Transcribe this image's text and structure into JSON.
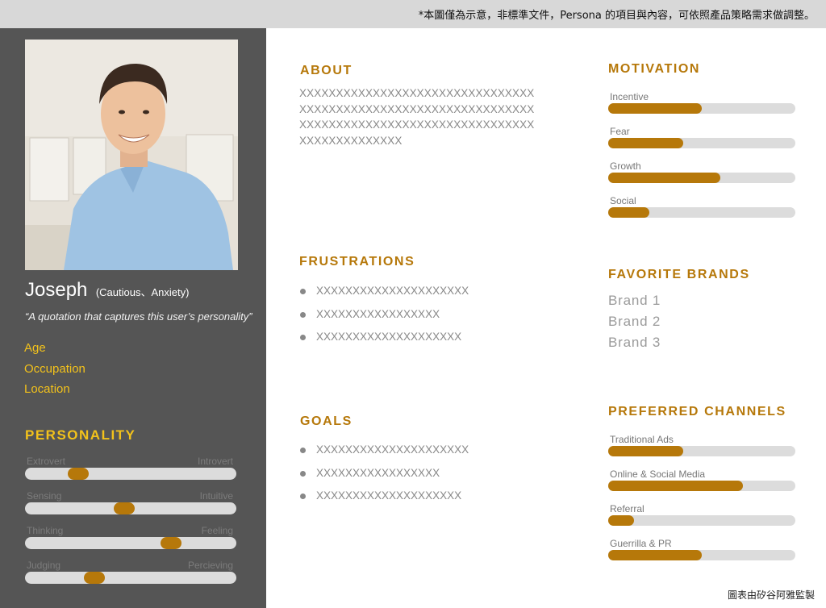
{
  "header": {
    "note": "*本圖僅為示意，非標準文件，Persona 的項目與內容，可依照產品策略需求做調整。"
  },
  "profile": {
    "name": "Joseph",
    "traits": "(Cautious、Anxiety)",
    "quote": "“A quotation that captures this user’s personality”",
    "facts": [
      "Age",
      "Occupation",
      "Location"
    ]
  },
  "personality": {
    "title": "PERSONALITY",
    "traits": [
      {
        "left": "Extrovert",
        "right": "Introvert",
        "value": 0.25
      },
      {
        "left": "Sensing",
        "right": "Intuitive",
        "value": 0.47
      },
      {
        "left": "Thinking",
        "right": "Feeling",
        "value": 0.69
      },
      {
        "left": "Judging",
        "right": "Percieving",
        "value": 0.33
      }
    ]
  },
  "about": {
    "title": "ABOUT",
    "lines": [
      "XXXXXXXXXXXXXXXXXXXXXXXXXXXXXXXX",
      "XXXXXXXXXXXXXXXXXXXXXXXXXXXXXXXX",
      "XXXXXXXXXXXXXXXXXXXXXXXXXXXXXXXX",
      "XXXXXXXXXXXXXX"
    ]
  },
  "frustrations": {
    "title": "FRUSTRATIONS",
    "items": [
      "XXXXXXXXXXXXXXXXXXXXX",
      "XXXXXXXXXXXXXXXXX",
      "XXXXXXXXXXXXXXXXXXXX"
    ]
  },
  "goals": {
    "title": "GOALS",
    "items": [
      "XXXXXXXXXXXXXXXXXXXXX",
      "XXXXXXXXXXXXXXXXX",
      "XXXXXXXXXXXXXXXXXXXX"
    ]
  },
  "motivation": {
    "title": "MOTIVATION",
    "items": [
      {
        "label": "Incentive",
        "value": 0.5
      },
      {
        "label": "Fear",
        "value": 0.4
      },
      {
        "label": "Growth",
        "value": 0.6
      },
      {
        "label": "Social",
        "value": 0.22
      }
    ]
  },
  "brands": {
    "title": "FAVORITE BRANDS",
    "items": [
      "Brand 1",
      "Brand 2",
      "Brand 3"
    ]
  },
  "channels": {
    "title": "PREFERRED CHANNELS",
    "items": [
      {
        "label": "Traditional Ads",
        "value": 0.4
      },
      {
        "label": "Online & Social Media",
        "value": 0.72
      },
      {
        "label": "Referral",
        "value": 0.14
      },
      {
        "label": "Guerrilla & PR",
        "value": 0.5
      }
    ]
  },
  "footer": {
    "credit": "圖表由矽谷阿雅監製"
  },
  "colors": {
    "accent": "#b6780a",
    "highlight": "#f3c21b",
    "sidebar": "#555555",
    "track": "#dcdcdc"
  }
}
